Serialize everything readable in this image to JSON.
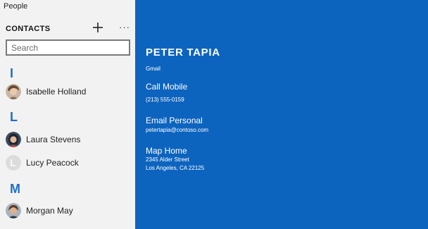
{
  "app": {
    "title": "People"
  },
  "sidebar": {
    "header": "CONTACTS",
    "add_icon": "plus-icon",
    "more_label": "···",
    "search": {
      "placeholder": "Search",
      "value": ""
    },
    "groups": [
      {
        "letter": "I",
        "contacts": [
          {
            "name": "Isabelle Holland",
            "avatar": "photo"
          }
        ]
      },
      {
        "letter": "L",
        "contacts": [
          {
            "name": "Laura Stevens",
            "avatar": "photo"
          },
          {
            "name": "Lucy Peacock",
            "avatar": "placeholder"
          }
        ]
      },
      {
        "letter": "M",
        "contacts": [
          {
            "name": "Morgan May",
            "avatar": "photo"
          }
        ]
      }
    ]
  },
  "details": {
    "name": "PETER TAPIA",
    "account": "Gmail",
    "call": {
      "label": "Call Mobile",
      "value": "(213) 555-0159"
    },
    "email": {
      "label": "Email Personal",
      "value": "petertapia@contoso.com"
    },
    "map": {
      "label": "Map Home",
      "line1": "2345 Alder Street",
      "line2": "Los Angeles, CA 22125"
    }
  },
  "colors": {
    "accent": "#1e6fc8",
    "detail_background": "#0d64bf",
    "sidebar_background": "#f2f2f2"
  }
}
